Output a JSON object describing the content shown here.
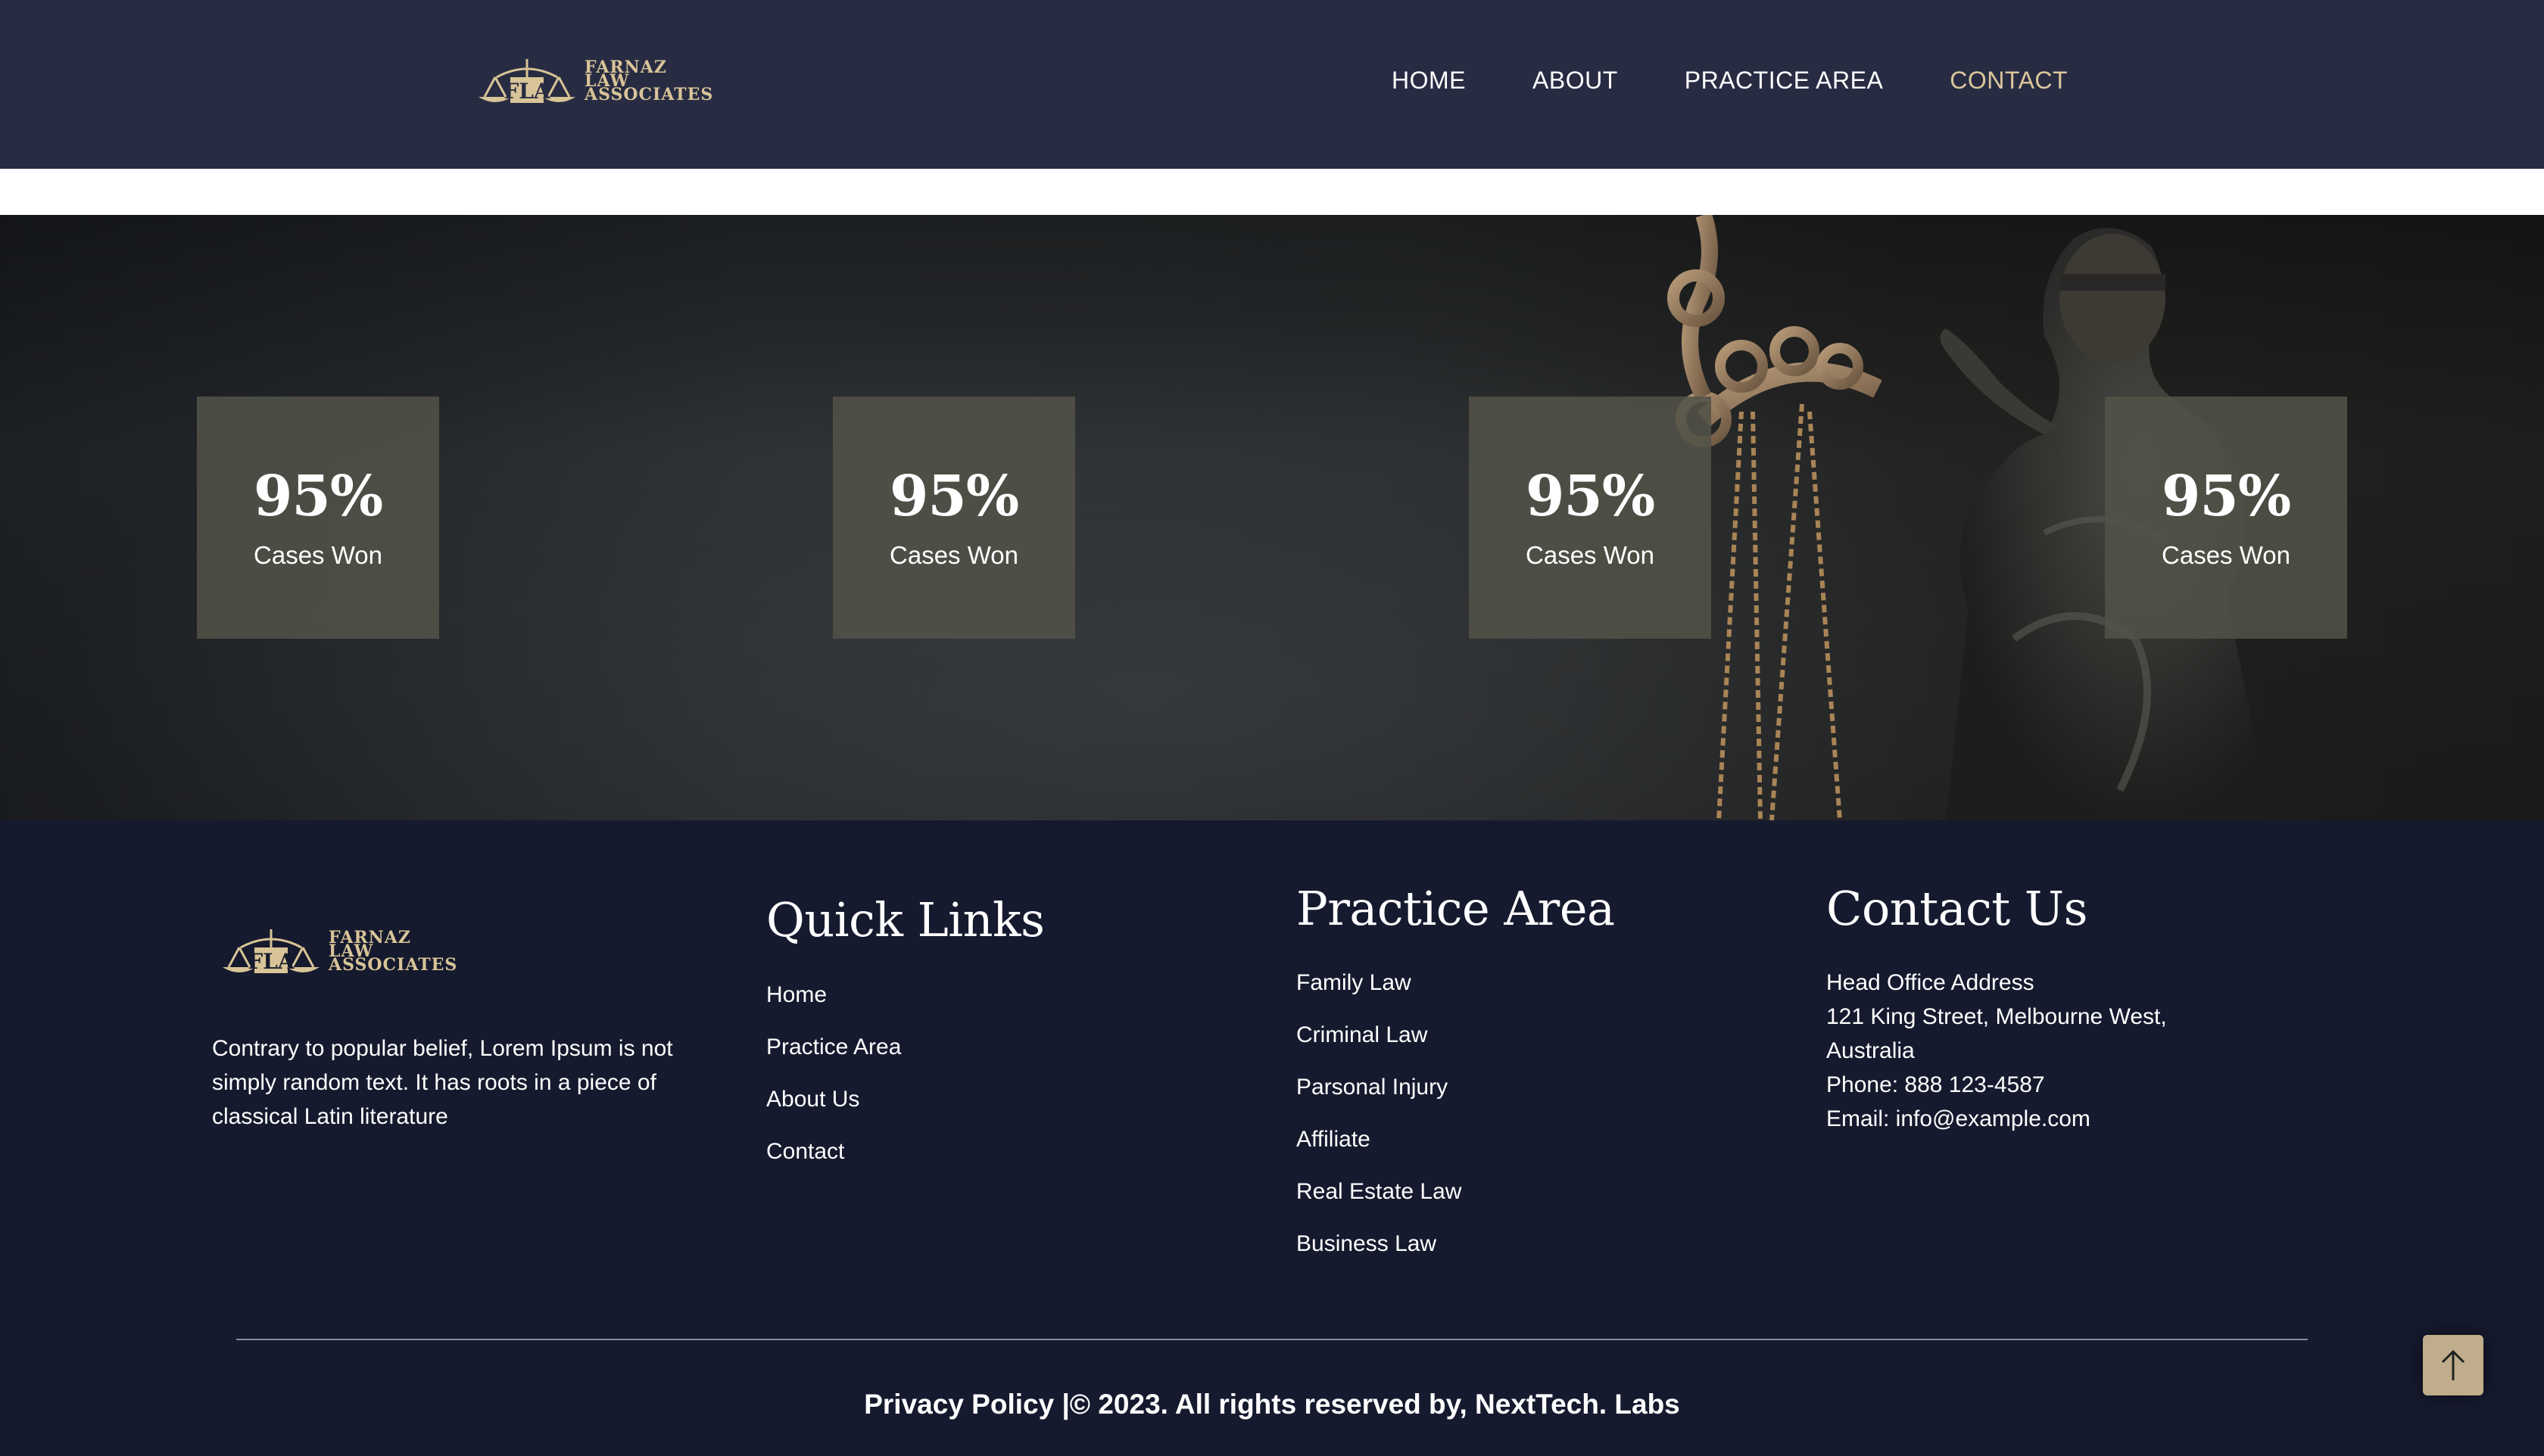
{
  "brand": {
    "logo_line1": "FARNAZ",
    "logo_line2": "LAW",
    "logo_line3": "ASSOCIATES",
    "logo_color": "#d8c497"
  },
  "nav": {
    "items": [
      {
        "label": "HOME",
        "active": false
      },
      {
        "label": "ABOUT",
        "active": false
      },
      {
        "label": "PRACTICE AREA",
        "active": false
      },
      {
        "label": "CONTACT",
        "active": true
      }
    ],
    "active_color": "#dbc79b"
  },
  "stats": [
    {
      "value": "95%",
      "label": "Cases Won"
    },
    {
      "value": "95%",
      "label": "Cases Won"
    },
    {
      "value": "95%",
      "label": "Cases Won"
    },
    {
      "value": "95%",
      "label": "Cases Won"
    }
  ],
  "footer": {
    "about_text": "Contrary to popular belief, Lorem Ipsum is not simply random text. It has roots in a piece of classical Latin literature",
    "quick_links": {
      "title": "Quick Links",
      "items": [
        "Home",
        "Practice Area",
        "About Us",
        "Contact"
      ]
    },
    "practice_area": {
      "title": "Practice Area",
      "items": [
        "Family Law",
        "Criminal Law",
        "Parsonal Injury",
        "Affiliate",
        "Real Estate Law",
        "Business Law"
      ]
    },
    "contact": {
      "title": "Contact Us",
      "lines": [
        "Head Office Address",
        "121 King Street, Melbourne West,",
        "Australia",
        "Phone: 888 123-4587",
        "Email: info@example.com"
      ]
    },
    "copyright": "Privacy Policy |© 2023. All rights reserved by, NextTech. Labs"
  },
  "scroll_top_icon": "arrow-up-icon",
  "colors": {
    "header_bg": "#282c43",
    "footer_bg": "#161a2e",
    "stat_box_bg": "#525248",
    "scroll_top_bg": "#bfad8b"
  }
}
